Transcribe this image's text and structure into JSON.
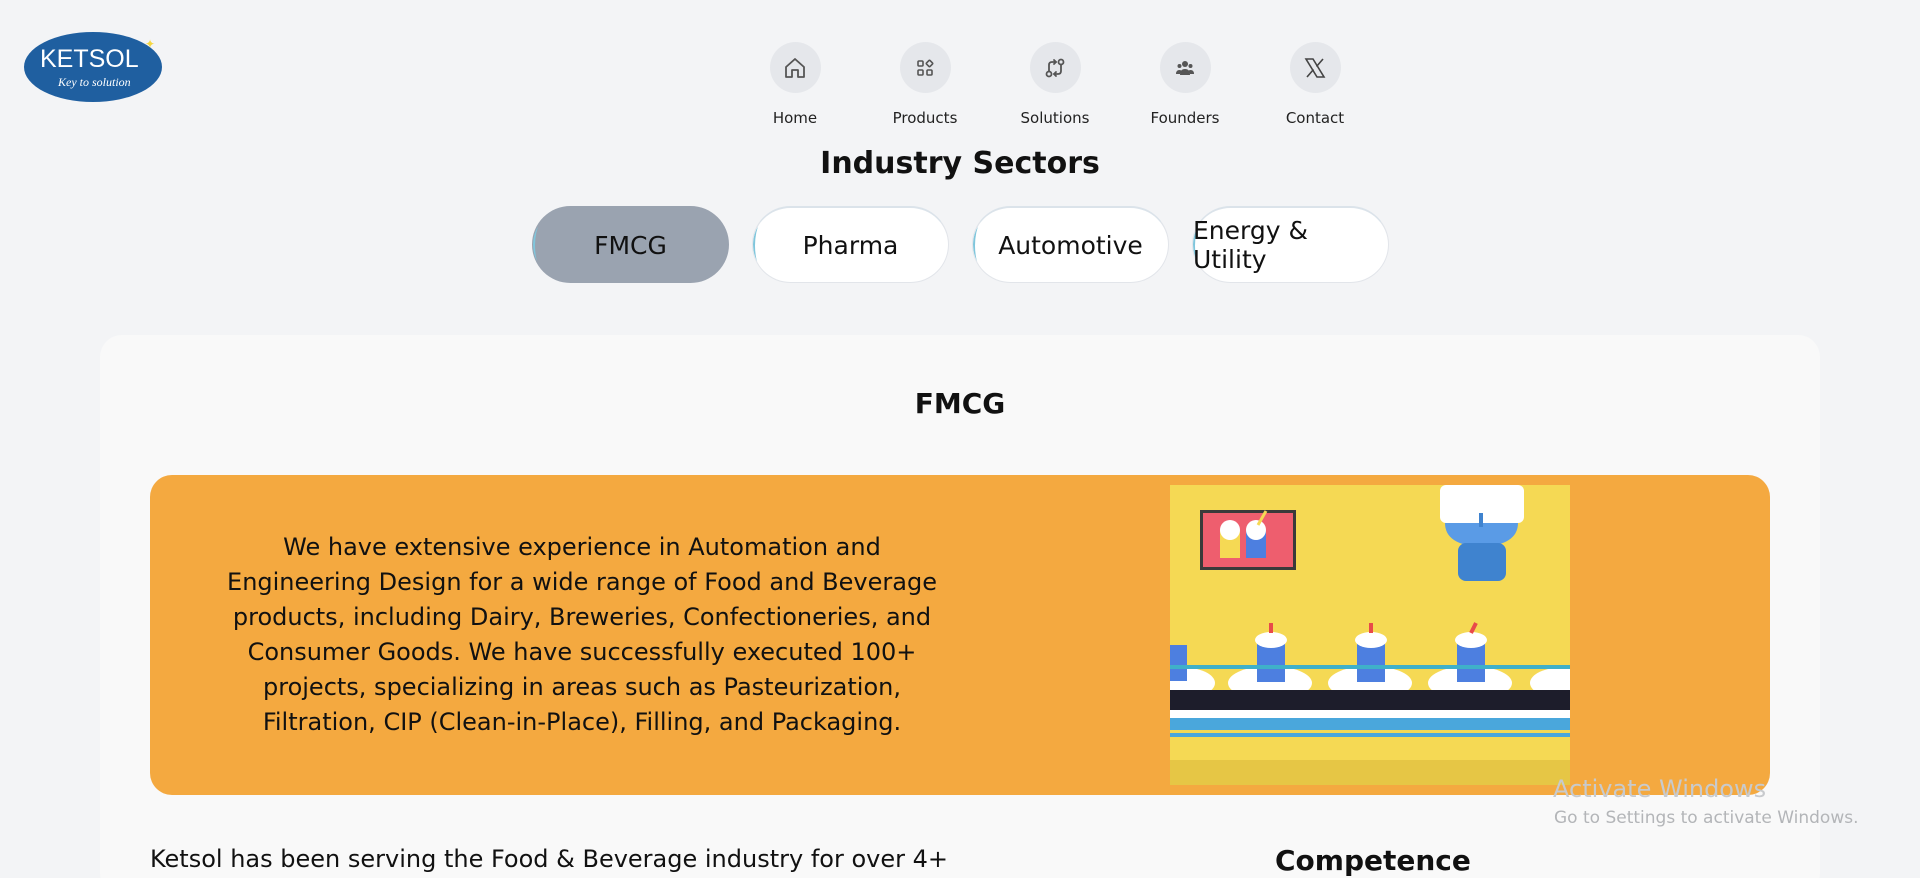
{
  "logo": {
    "text": "KETSOL",
    "tagline": "Key to solution"
  },
  "nav": {
    "items": [
      {
        "label": "Home",
        "icon": "home-icon"
      },
      {
        "label": "Products",
        "icon": "grid-icon"
      },
      {
        "label": "Solutions",
        "icon": "exchange-icon"
      },
      {
        "label": "Founders",
        "icon": "people-icon"
      },
      {
        "label": "Contact",
        "icon": "x-icon"
      }
    ]
  },
  "sectors": {
    "title": "Industry Sectors",
    "tabs": [
      {
        "label": "FMCG",
        "active": true
      },
      {
        "label": "Pharma",
        "active": false
      },
      {
        "label": "Automotive",
        "active": false
      },
      {
        "label": "Energy & Utility",
        "active": false
      }
    ]
  },
  "content": {
    "title": "FMCG",
    "banner_text": "We have extensive experience in Automation and Engineering Design for a wide range of Food and Beverage products, including Dairy, Breweries, Confectioneries, and Consumer Goods. We have successfully executed 100+ projects, specializing in areas such as Pasteurization, Filtration, CIP (Clean-in-Place), Filling, and Packaging.",
    "body_text": "Ketsol has been serving the Food & Beverage industry for over 4+",
    "competence_heading": "Competence"
  },
  "colors": {
    "banner": "#f4a940",
    "active_tab": "#9aa3b0",
    "logo_blue": "#1f5fa0"
  },
  "watermark": {
    "title": "Activate Windows",
    "subtitle": "Go to Settings to activate Windows."
  }
}
